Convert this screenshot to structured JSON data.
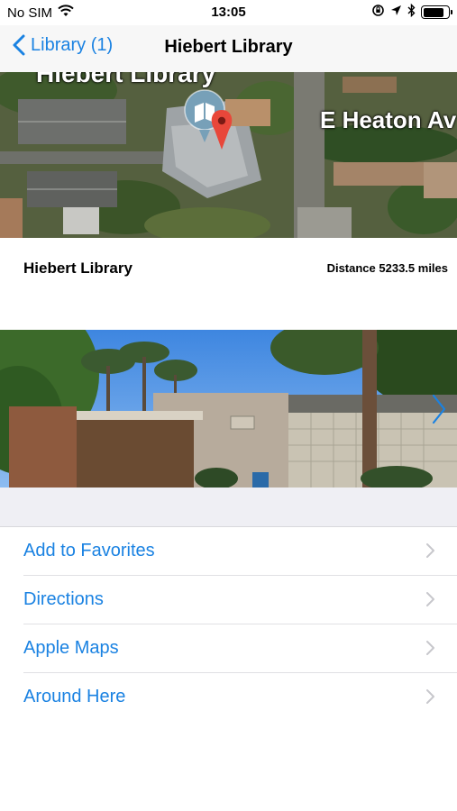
{
  "status_bar": {
    "carrier": "No SIM",
    "time": "13:05",
    "battery_level": 0.85
  },
  "nav": {
    "back_label": "Library (1)",
    "title": "Hiebert Library"
  },
  "map": {
    "top_label": "Hiebert Library",
    "street_label": "E Heaton Av"
  },
  "place": {
    "name": "Hiebert Library",
    "distance": "Distance 5233.5 miles"
  },
  "actions": [
    {
      "label": "Add to Favorites"
    },
    {
      "label": "Directions"
    },
    {
      "label": "Apple Maps"
    },
    {
      "label": "Around Here"
    }
  ],
  "colors": {
    "accent": "#1a82e2",
    "pin": "#e8473a"
  }
}
